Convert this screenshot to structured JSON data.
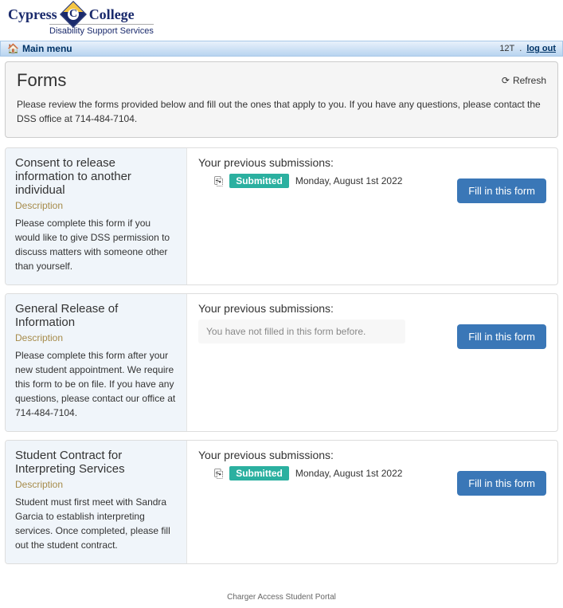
{
  "branding": {
    "name_left": "Cypress",
    "name_right": "College",
    "subtitle": "Disability Support Services"
  },
  "nav": {
    "main_menu": "Main menu",
    "user": "12T",
    "logout": "log out"
  },
  "header": {
    "title": "Forms",
    "refresh": "Refresh",
    "intro": "Please review the forms provided below and fill out the ones that apply to you. If you have any questions, please contact the DSS office at 714-484-7104."
  },
  "labels": {
    "description": "Description",
    "previous_submissions": "Your previous submissions:",
    "fill_button": "Fill in this form",
    "empty": "You have not filled in this form before."
  },
  "forms": [
    {
      "title": "Consent to release information to another individual",
      "description": "Please complete this form if you would like to give DSS permission to discuss matters with someone other than yourself.",
      "submission": {
        "status": "Submitted",
        "date": "Monday, August 1st 2022"
      }
    },
    {
      "title": "General Release of Information",
      "description": "Please complete this form after your new student appointment. We require this form to be on file. If you have any questions, please contact our office at 714-484-7104.",
      "submission": null
    },
    {
      "title": "Student Contract for Interpreting Services",
      "description": "Student must first meet with Sandra Garcia to establish interpreting services. Once completed, please fill out the student contract.",
      "submission": {
        "status": "Submitted",
        "date": "Monday, August 1st 2022"
      }
    }
  ],
  "footer": "Charger Access Student Portal"
}
